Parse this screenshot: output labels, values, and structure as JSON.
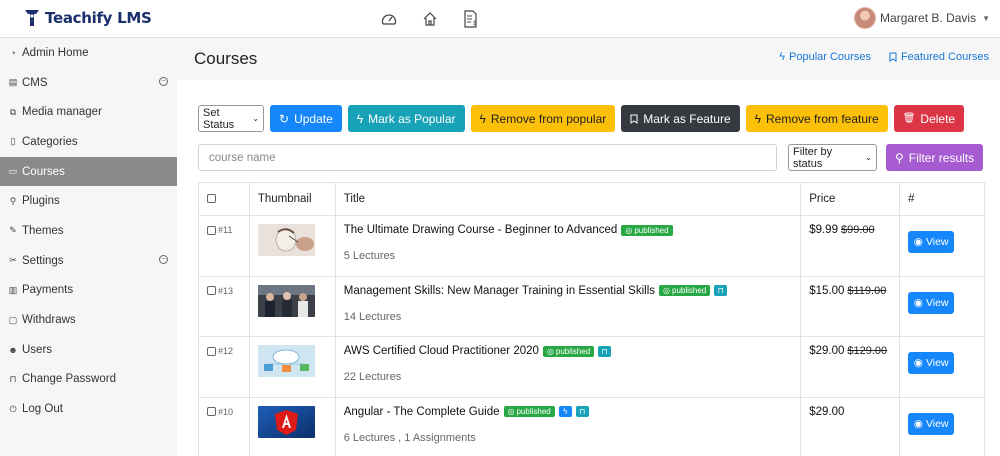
{
  "brand": {
    "name": "Teachify LMS",
    "color": "#1a2f6b"
  },
  "topnav": {
    "icons": [
      "dashboard-icon",
      "home-icon",
      "invoice-icon"
    ]
  },
  "user": {
    "name": "Margaret B. Davis"
  },
  "sidebar": {
    "items": [
      {
        "label": "Admin Home",
        "icon": "gauge-icon"
      },
      {
        "label": "CMS",
        "icon": "cms-icon",
        "toggle": "⊖"
      },
      {
        "label": "Media manager",
        "icon": "media-icon"
      },
      {
        "label": "Categories",
        "icon": "folder-icon"
      },
      {
        "label": "Courses",
        "icon": "courses-icon",
        "active": true
      },
      {
        "label": "Plugins",
        "icon": "plug-icon"
      },
      {
        "label": "Themes",
        "icon": "brush-icon"
      },
      {
        "label": "Settings",
        "icon": "tools-icon",
        "toggle": "⊖"
      },
      {
        "label": "Payments",
        "icon": "receipt-icon"
      },
      {
        "label": "Withdraws",
        "icon": "wallet-icon"
      },
      {
        "label": "Users",
        "icon": "users-icon"
      },
      {
        "label": "Change Password",
        "icon": "lock-icon"
      },
      {
        "label": "Log Out",
        "icon": "logout-icon"
      }
    ]
  },
  "page": {
    "title": "Courses",
    "links": [
      {
        "label": "Popular Courses",
        "icon": "bolt-icon"
      },
      {
        "label": "Featured Courses",
        "icon": "bookmark-icon"
      }
    ]
  },
  "toolbar": {
    "set_status": "Set Status",
    "update": "Update",
    "mark_popular": "Mark as Popular",
    "remove_popular": "Remove from popular",
    "mark_feature": "Mark as Feature",
    "remove_feature": "Remove from feature",
    "delete": "Delete"
  },
  "filters": {
    "search_placeholder": "course name",
    "status_select": "Filter by status",
    "filter_button": "Filter results"
  },
  "table": {
    "headers": {
      "thumbnail": "Thumbnail",
      "title": "Title",
      "price": "Price",
      "actions": "#"
    },
    "rows": [
      {
        "id": "#11",
        "title": "The Ultimate Drawing Course - Beginner to Advanced",
        "status": "published",
        "meta": "5 Lectures",
        "price": "$9.99",
        "old_price": "$99.00",
        "view": "View"
      },
      {
        "id": "#13",
        "title": "Management Skills: New Manager Training in Essential Skills",
        "status": "published",
        "meta": "14 Lectures",
        "price": "$15.00",
        "old_price": "$119.00",
        "view": "View"
      },
      {
        "id": "#12",
        "title": "AWS Certified Cloud Practitioner 2020",
        "status": "published",
        "meta": "22 Lectures",
        "price": "$29.00",
        "old_price": "$129.00",
        "view": "View"
      },
      {
        "id": "#10",
        "title": "Angular - The Complete Guide",
        "status": "published",
        "meta": "6 Lectures , 1 Assignments",
        "price": "$29.00",
        "old_price": "",
        "view": "View"
      }
    ]
  },
  "colors": {
    "primary": "#1687fb",
    "teal": "#18a2b8",
    "yellow": "#fdc009",
    "dark": "#343a40",
    "red": "#dc3545",
    "purple": "#a65bd0",
    "green": "#28a745"
  }
}
